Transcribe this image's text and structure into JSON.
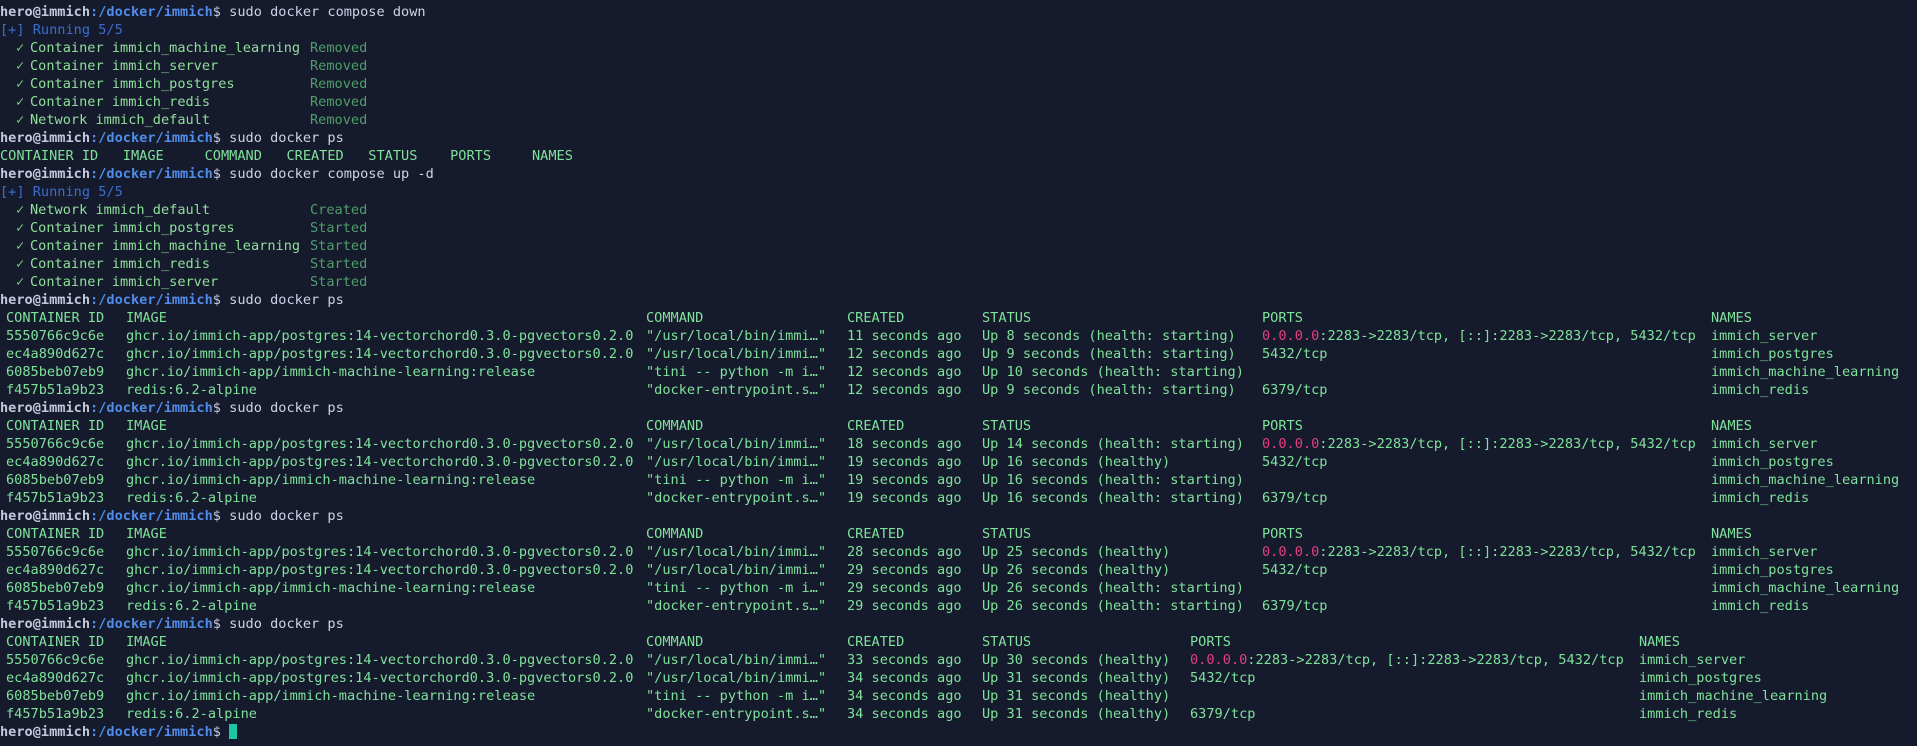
{
  "prompt": {
    "user_host": "hero@immich",
    "path": ":/docker/immich",
    "symbol": "$ "
  },
  "commands": {
    "down": "sudo docker compose down",
    "ps": "sudo docker ps",
    "up": "sudo docker compose up -d"
  },
  "running_label": "[+] Running 5/5",
  "check": "✓",
  "down_results": [
    {
      "name": "Container immich_machine_learning",
      "status": "Removed"
    },
    {
      "name": "Container immich_server",
      "status": "Removed"
    },
    {
      "name": "Container immich_postgres",
      "status": "Removed"
    },
    {
      "name": "Container immich_redis",
      "status": "Removed"
    },
    {
      "name": "Network immich_default",
      "status": "Removed"
    }
  ],
  "empty_ps_header": "CONTAINER ID   IMAGE     COMMAND   CREATED   STATUS    PORTS     NAMES",
  "up_results": [
    {
      "name": "Network immich_default",
      "status": "Created"
    },
    {
      "name": "Container immich_postgres",
      "status": "Started"
    },
    {
      "name": "Container immich_machine_learning",
      "status": "Started"
    },
    {
      "name": "Container immich_redis",
      "status": "Started"
    },
    {
      "name": "Container immich_server",
      "status": "Started"
    }
  ],
  "headers": {
    "id": "CONTAINER ID",
    "image": "IMAGE",
    "command": "COMMAND",
    "created": "CREATED",
    "status": "STATUS",
    "ports": "PORTS",
    "names": "NAMES"
  },
  "ps_tables": [
    {
      "rows": [
        {
          "id": "5550766c9c6e",
          "image": "ghcr.io/immich-app/postgres:14-vectorchord0.3.0-pgvectors0.2.0",
          "command": "\"/usr/local/bin/immi…\"",
          "created": "11 seconds ago",
          "status": "Up 8 seconds (health: starting)",
          "ports_ip": "0.0.0.0",
          "ports_rest": ":2283->2283/tcp, [::]:2283->2283/tcp, 5432/tcp",
          "names": "immich_server"
        },
        {
          "id": "ec4a890d627c",
          "image": "ghcr.io/immich-app/postgres:14-vectorchord0.3.0-pgvectors0.2.0",
          "command": "\"/usr/local/bin/immi…\"",
          "created": "12 seconds ago",
          "status": "Up 9 seconds (health: starting)",
          "ports_ip": "",
          "ports_rest": "5432/tcp",
          "names": "immich_postgres"
        },
        {
          "id": "6085beb07eb9",
          "image": "ghcr.io/immich-app/immich-machine-learning:release",
          "command": "\"tini -- python -m i…\"",
          "created": "12 seconds ago",
          "status": "Up 10 seconds (health: starting)",
          "ports_ip": "",
          "ports_rest": "",
          "names": "immich_machine_learning"
        },
        {
          "id": "f457b51a9b23",
          "image": "redis:6.2-alpine",
          "command": "\"docker-entrypoint.s…\"",
          "created": "12 seconds ago",
          "status": "Up 9 seconds (health: starting)",
          "ports_ip": "",
          "ports_rest": "6379/tcp",
          "names": "immich_redis"
        }
      ]
    },
    {
      "rows": [
        {
          "id": "5550766c9c6e",
          "image": "ghcr.io/immich-app/postgres:14-vectorchord0.3.0-pgvectors0.2.0",
          "command": "\"/usr/local/bin/immi…\"",
          "created": "18 seconds ago",
          "status": "Up 14 seconds (health: starting)",
          "ports_ip": "0.0.0.0",
          "ports_rest": ":2283->2283/tcp, [::]:2283->2283/tcp, 5432/tcp",
          "names": "immich_server"
        },
        {
          "id": "ec4a890d627c",
          "image": "ghcr.io/immich-app/postgres:14-vectorchord0.3.0-pgvectors0.2.0",
          "command": "\"/usr/local/bin/immi…\"",
          "created": "19 seconds ago",
          "status": "Up 16 seconds (healthy)",
          "ports_ip": "",
          "ports_rest": "5432/tcp",
          "names": "immich_postgres"
        },
        {
          "id": "6085beb07eb9",
          "image": "ghcr.io/immich-app/immich-machine-learning:release",
          "command": "\"tini -- python -m i…\"",
          "created": "19 seconds ago",
          "status": "Up 16 seconds (health: starting)",
          "ports_ip": "",
          "ports_rest": "",
          "names": "immich_machine_learning"
        },
        {
          "id": "f457b51a9b23",
          "image": "redis:6.2-alpine",
          "command": "\"docker-entrypoint.s…\"",
          "created": "19 seconds ago",
          "status": "Up 16 seconds (health: starting)",
          "ports_ip": "",
          "ports_rest": "6379/tcp",
          "names": "immich_redis"
        }
      ]
    },
    {
      "rows": [
        {
          "id": "5550766c9c6e",
          "image": "ghcr.io/immich-app/postgres:14-vectorchord0.3.0-pgvectors0.2.0",
          "command": "\"/usr/local/bin/immi…\"",
          "created": "28 seconds ago",
          "status": "Up 25 seconds (healthy)",
          "ports_ip": "0.0.0.0",
          "ports_rest": ":2283->2283/tcp, [::]:2283->2283/tcp, 5432/tcp",
          "names": "immich_server"
        },
        {
          "id": "ec4a890d627c",
          "image": "ghcr.io/immich-app/postgres:14-vectorchord0.3.0-pgvectors0.2.0",
          "command": "\"/usr/local/bin/immi…\"",
          "created": "29 seconds ago",
          "status": "Up 26 seconds (healthy)",
          "ports_ip": "",
          "ports_rest": "5432/tcp",
          "names": "immich_postgres"
        },
        {
          "id": "6085beb07eb9",
          "image": "ghcr.io/immich-app/immich-machine-learning:release",
          "command": "\"tini -- python -m i…\"",
          "created": "29 seconds ago",
          "status": "Up 26 seconds (health: starting)",
          "ports_ip": "",
          "ports_rest": "",
          "names": "immich_machine_learning"
        },
        {
          "id": "f457b51a9b23",
          "image": "redis:6.2-alpine",
          "command": "\"docker-entrypoint.s…\"",
          "created": "29 seconds ago",
          "status": "Up 26 seconds (health: starting)",
          "ports_ip": "",
          "ports_rest": "6379/tcp",
          "names": "immich_redis"
        }
      ]
    },
    {
      "rows": [
        {
          "id": "5550766c9c6e",
          "image": "ghcr.io/immich-app/postgres:14-vectorchord0.3.0-pgvectors0.2.0",
          "command": "\"/usr/local/bin/immi…\"",
          "created": "33 seconds ago",
          "status": "Up 30 seconds (healthy)",
          "ports_ip": "0.0.0.0",
          "ports_rest": ":2283->2283/tcp, [::]:2283->2283/tcp, 5432/tcp",
          "names": "immich_server"
        },
        {
          "id": "ec4a890d627c",
          "image": "ghcr.io/immich-app/postgres:14-vectorchord0.3.0-pgvectors0.2.0",
          "command": "\"/usr/local/bin/immi…\"",
          "created": "34 seconds ago",
          "status": "Up 31 seconds (healthy)",
          "ports_ip": "",
          "ports_rest": "5432/tcp",
          "names": "immich_postgres"
        },
        {
          "id": "6085beb07eb9",
          "image": "ghcr.io/immich-app/immich-machine-learning:release",
          "command": "\"tini -- python -m i…\"",
          "created": "34 seconds ago",
          "status": "Up 31 seconds (healthy)",
          "ports_ip": "",
          "ports_rest": "",
          "names": "immich_machine_learning"
        },
        {
          "id": "f457b51a9b23",
          "image": "redis:6.2-alpine",
          "command": "\"docker-entrypoint.s…\"",
          "created": "34 seconds ago",
          "status": "Up 31 seconds (healthy)",
          "ports_ip": "",
          "ports_rest": "6379/tcp",
          "names": "immich_redis"
        }
      ]
    }
  ]
}
